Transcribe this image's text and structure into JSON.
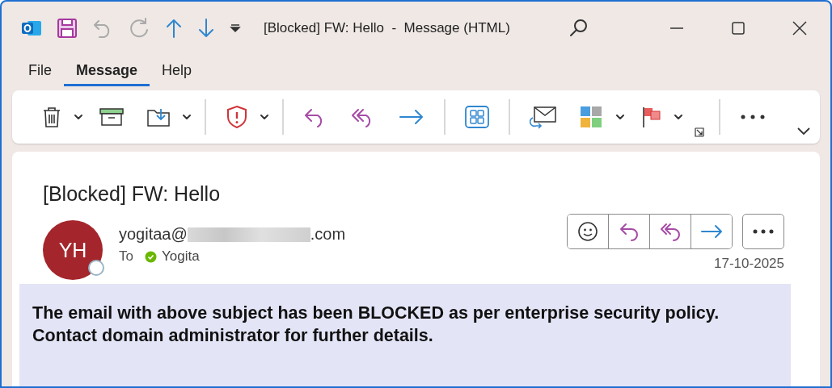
{
  "window": {
    "title": "[Blocked] FW: Hello  -  Message (HTML)"
  },
  "menu_tabs": [
    {
      "label": "File",
      "selected": false
    },
    {
      "label": "Message",
      "selected": true
    },
    {
      "label": "Help",
      "selected": false
    }
  ],
  "message": {
    "subject": "[Blocked] FW: Hello",
    "sender": {
      "initials": "YH",
      "address_start": "yogitaa@",
      "address_end": ".com",
      "address_redacted": true
    },
    "to_label": "To",
    "recipients": [
      {
        "name": "Yogita",
        "color": "#6bb700"
      }
    ],
    "date": "17-10-2025",
    "body_lines": [
      "The email with above subject has been BLOCKED as per enterprise security policy.",
      "Contact domain administrator for further details."
    ]
  }
}
